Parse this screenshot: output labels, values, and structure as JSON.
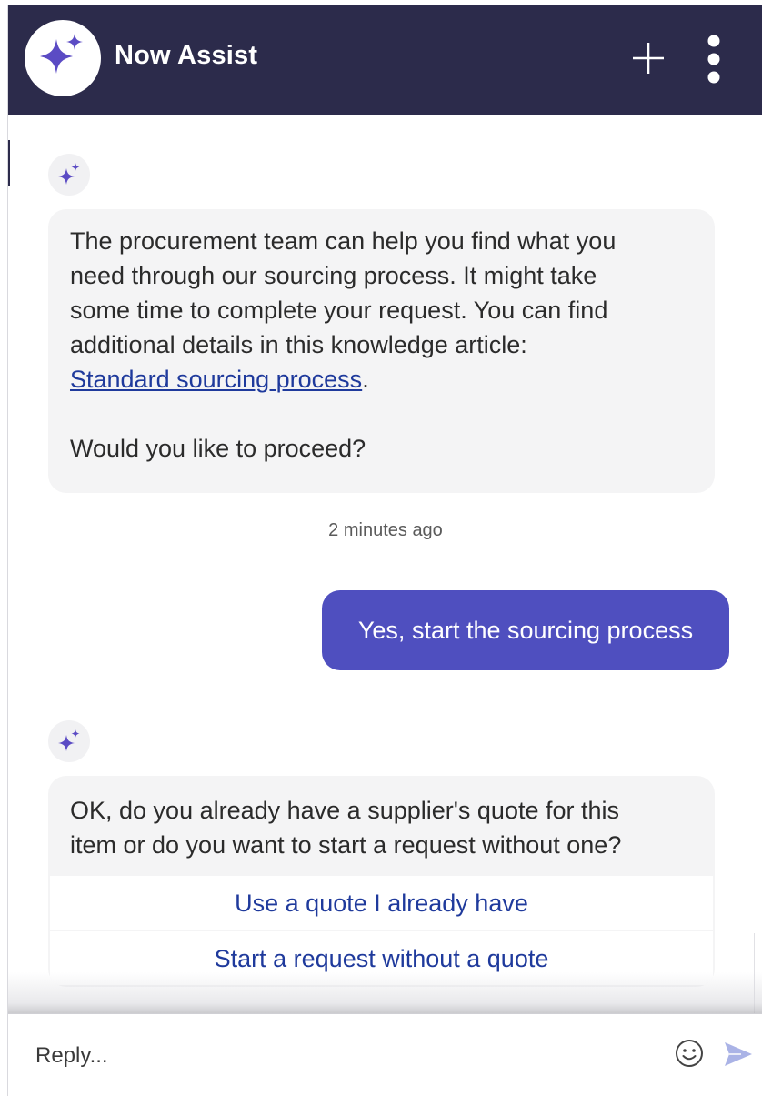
{
  "header": {
    "title": "Now Assist",
    "logo_icon": "sparkle-icon",
    "new_chat_icon": "plus-icon",
    "menu_icon": "vertical-dots-icon",
    "background": "#2c2b4b"
  },
  "messages": {
    "bot_1": {
      "avatar_icon": "sparkle-icon",
      "lines": [
        "The procurement team can help you find what you",
        "need through our sourcing process. It might take",
        "some time to complete your request. You can find",
        "additional details in this knowledge article:"
      ],
      "link_text": "Standard sourcing process",
      "link_suffix": ".",
      "question": "Would you like to proceed?"
    },
    "timestamp": "2 minutes ago",
    "user_1": {
      "text": "Yes, start the sourcing process"
    },
    "bot_2": {
      "avatar_icon": "sparkle-icon",
      "lines": [
        "OK, do you already have a supplier's quote for this",
        "item or do you want to start a request without one?"
      ],
      "options": [
        "Use a quote I already have",
        "Start a request without a quote"
      ]
    }
  },
  "composer": {
    "placeholder": "Reply...",
    "emoji_icon": "smiley-icon",
    "send_icon": "send-icon"
  },
  "colors": {
    "accent": "#5b4bc4",
    "user_bubble": "#4f4fbf",
    "link": "#1f3a9c",
    "bot_bubble": "#f4f4f5"
  }
}
